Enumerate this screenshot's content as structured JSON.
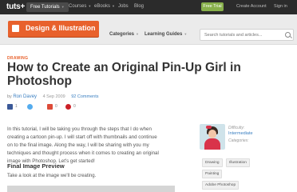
{
  "topnav": {
    "logo": "tuts+",
    "items": [
      {
        "label": "Free Tutorials",
        "active": true
      },
      {
        "label": "Courses",
        "active": false
      },
      {
        "label": "eBooks",
        "active": false
      },
      {
        "label": "Jobs",
        "active": false
      },
      {
        "label": "Blog",
        "active": false
      }
    ],
    "free_trial": "Free Trial",
    "create_account": "Create Account",
    "sign_in": "Sign in"
  },
  "subheader": {
    "section": "Design & Illustration",
    "categories": "Categories",
    "learning_guides": "Learning Guides",
    "search_placeholder": "Search tutorials and articles..."
  },
  "article": {
    "category": "DRAWING",
    "title": "How to Create an Original Pin-Up Girl in Photoshop",
    "by": "by",
    "author": "Ron Davey",
    "date": "4 Sep 2009",
    "comments": "92 Comments",
    "share_counts": [
      "1",
      "0",
      "0"
    ],
    "intro": "In this tutorial, I will be taking you through the steps that I do when creating a cartoon pin-up. I will start off with thumbnails and continue on to the final image. Along the way, I will be sharing with you my techniques and thought process when it comes to creating an original image with Photoshop. Let's get started!",
    "preview_heading": "Final Image Preview",
    "preview_text": "Take a look at the image we'll be creating."
  },
  "sidebar": {
    "difficulty_label": "Difficulty:",
    "difficulty": "Intermediate",
    "categories_label": "Categories:",
    "tags": [
      "Drawing",
      "Illustration",
      "Painting",
      "Adobe Photoshop"
    ]
  },
  "colors": {
    "accent": "#e8612c",
    "link": "#3a7fc1",
    "trial": "#88b04b"
  }
}
